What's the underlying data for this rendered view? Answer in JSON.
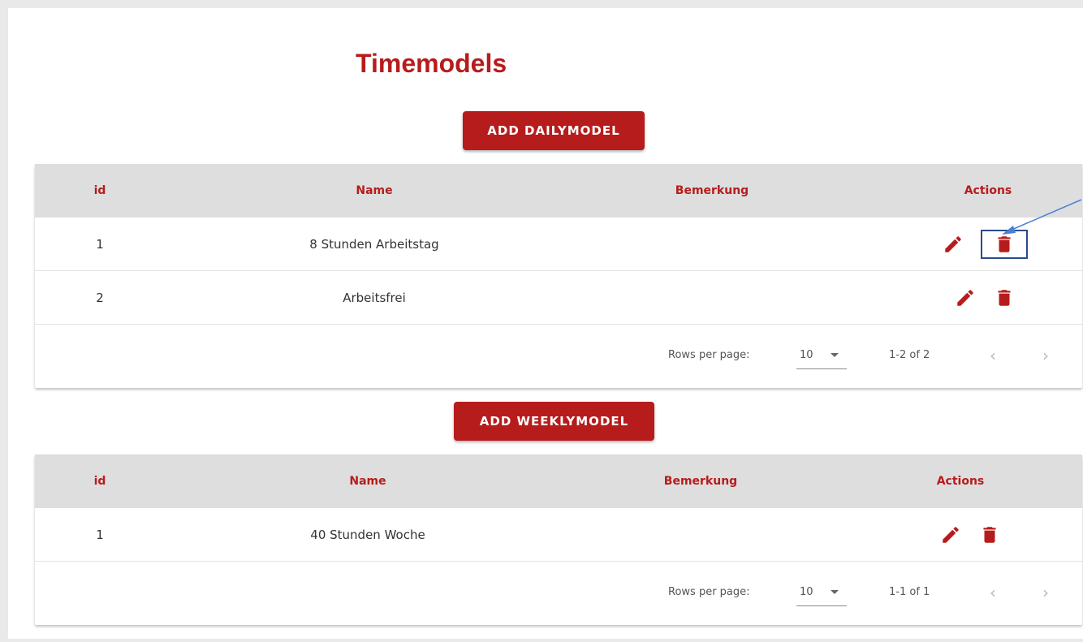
{
  "page": {
    "title": "Timemodels"
  },
  "colors": {
    "accent": "#b71c1c",
    "header_bg": "#dedede",
    "annotation": "#2c4a8c",
    "arrow": "#4a7fd4"
  },
  "daily": {
    "add_button": "ADD DAILYMODEL",
    "columns": [
      "id",
      "Name",
      "Bemerkung",
      "Actions"
    ],
    "rows": [
      {
        "id": "1",
        "name": "8 Stunden Arbeitstag",
        "note": ""
      },
      {
        "id": "2",
        "name": "Arbeitsfrei",
        "note": ""
      }
    ],
    "footer": {
      "rows_per_page_label": "Rows per page:",
      "rows_per_page_value": "10",
      "range": "1-2 of 2"
    }
  },
  "weekly": {
    "add_button": "ADD WEEKLYMODEL",
    "columns": [
      "id",
      "Name",
      "Bemerkung",
      "Actions"
    ],
    "rows": [
      {
        "id": "1",
        "name": "40 Stunden Woche",
        "note": ""
      }
    ],
    "footer": {
      "rows_per_page_label": "Rows per page:",
      "rows_per_page_value": "10",
      "range": "1-1 of 1"
    }
  },
  "icons": {
    "edit": "pencil-icon",
    "delete": "trash-icon",
    "prev": "chevron-left-icon",
    "next": "chevron-right-icon",
    "dropdown": "caret-down-icon"
  }
}
